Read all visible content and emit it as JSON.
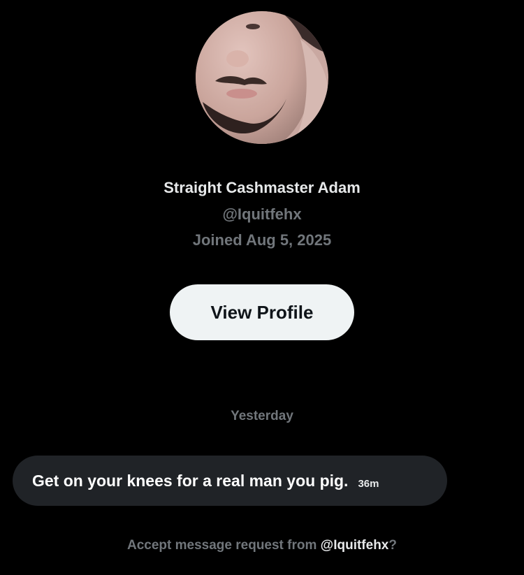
{
  "colors": {
    "background": "#000000",
    "primary_text": "#e7e9ea",
    "secondary_text": "#71767b",
    "button_background": "#eff3f4",
    "button_text": "#0f1419",
    "bubble_background": "#202327"
  },
  "profile": {
    "avatar_icon": "user-photo",
    "display_name": "Straight Cashmaster Adam",
    "handle": "@Iquitfehx",
    "joined": "Joined Aug 5, 2025",
    "view_profile_label": "View Profile"
  },
  "conversation": {
    "date_divider": "Yesterday",
    "messages": [
      {
        "text": "Get on your knees for a real man you pig.",
        "time": "36m"
      }
    ]
  },
  "request": {
    "prefix": "Accept message request from ",
    "handle": "@Iquitfehx",
    "suffix": "?"
  }
}
